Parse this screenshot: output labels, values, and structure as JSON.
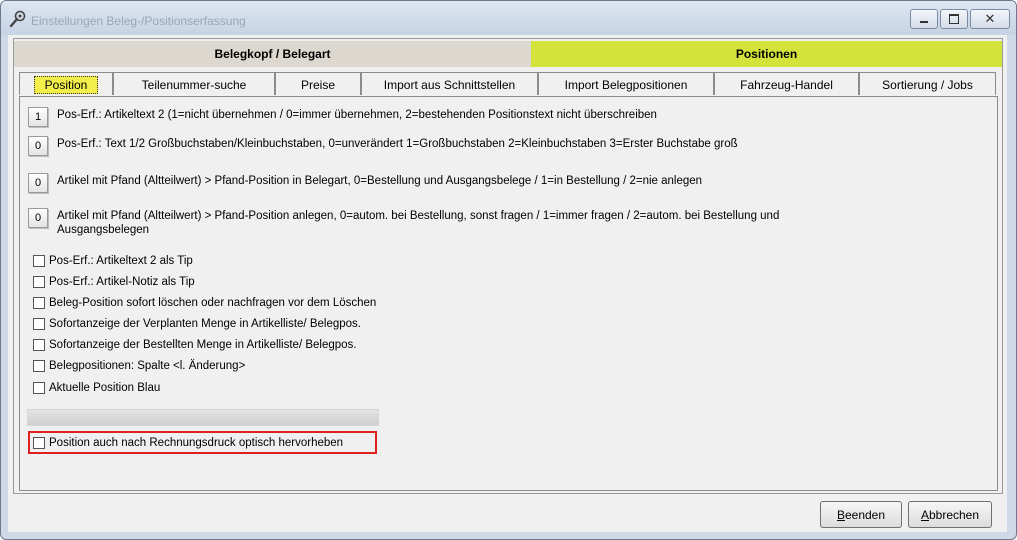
{
  "window": {
    "title": "Einstellungen Beleg-/Positionserfassung",
    "close_glyph": "✕"
  },
  "top_tabs": [
    {
      "label": "Belegkopf / Belegart"
    },
    {
      "label": "Positionen"
    }
  ],
  "sub_tabs": [
    {
      "label": "Position"
    },
    {
      "label": "Teilenummer-suche"
    },
    {
      "label": "Preise"
    },
    {
      "label": "Import aus Schnittstellen"
    },
    {
      "label": "Import Belegpositionen"
    },
    {
      "label": "Fahrzeug-Handel"
    },
    {
      "label": "Sortierung / Jobs"
    }
  ],
  "value_settings": [
    {
      "value": "1",
      "text": "Pos-Erf.: Artikeltext 2 (1=nicht übernehmen / 0=immer übernehmen, 2=bestehenden Positionstext nicht überschreiben"
    },
    {
      "value": "0",
      "text": "Pos-Erf.: Text 1/2 Großbuchstaben/Kleinbuchstaben, 0=unverändert 1=Großbuchstaben 2=Kleinbuchstaben 3=Erster Buchstabe groß"
    },
    {
      "value": "0",
      "text": "Artikel mit Pfand (Altteilwert) > Pfand-Position in Belegart, 0=Bestellung und Ausgangsbelege / 1=in Bestellung / 2=nie anlegen"
    },
    {
      "value": "0",
      "text": "Artikel mit Pfand (Altteilwert) > Pfand-Position anlegen, 0=autom. bei Bestellung, sonst fragen / 1=immer fragen / 2=autom. bei Bestellung und Ausgangsbelegen"
    }
  ],
  "checkboxes": [
    {
      "label": "Pos-Erf.: Artikeltext 2 als Tip"
    },
    {
      "label": "Pos-Erf.: Artikel-Notiz als Tip"
    },
    {
      "label": "Beleg-Position sofort löschen oder nachfragen vor dem Löschen"
    },
    {
      "label": "Sofortanzeige der Verplanten Menge in Artikelliste/ Belegpos."
    },
    {
      "label": "Sofortanzeige der Bestellten Menge in Artikelliste/ Belegpos."
    },
    {
      "label": "Belegpositionen: Spalte <l. Änderung>"
    },
    {
      "label": "Aktuelle Position Blau"
    }
  ],
  "highlighted_checkbox": {
    "label": "Position auch nach Rechnungsdruck optisch hervorheben"
  },
  "footer": {
    "beenden_first": "B",
    "beenden_rest": "eenden",
    "abbrechen_first": "A",
    "abbrechen_rest": "bbrechen"
  },
  "colors": {
    "top_tab_active": "#d4e339",
    "sub_tab_active": "#f2ef4a",
    "highlight_border": "#e0201e"
  }
}
